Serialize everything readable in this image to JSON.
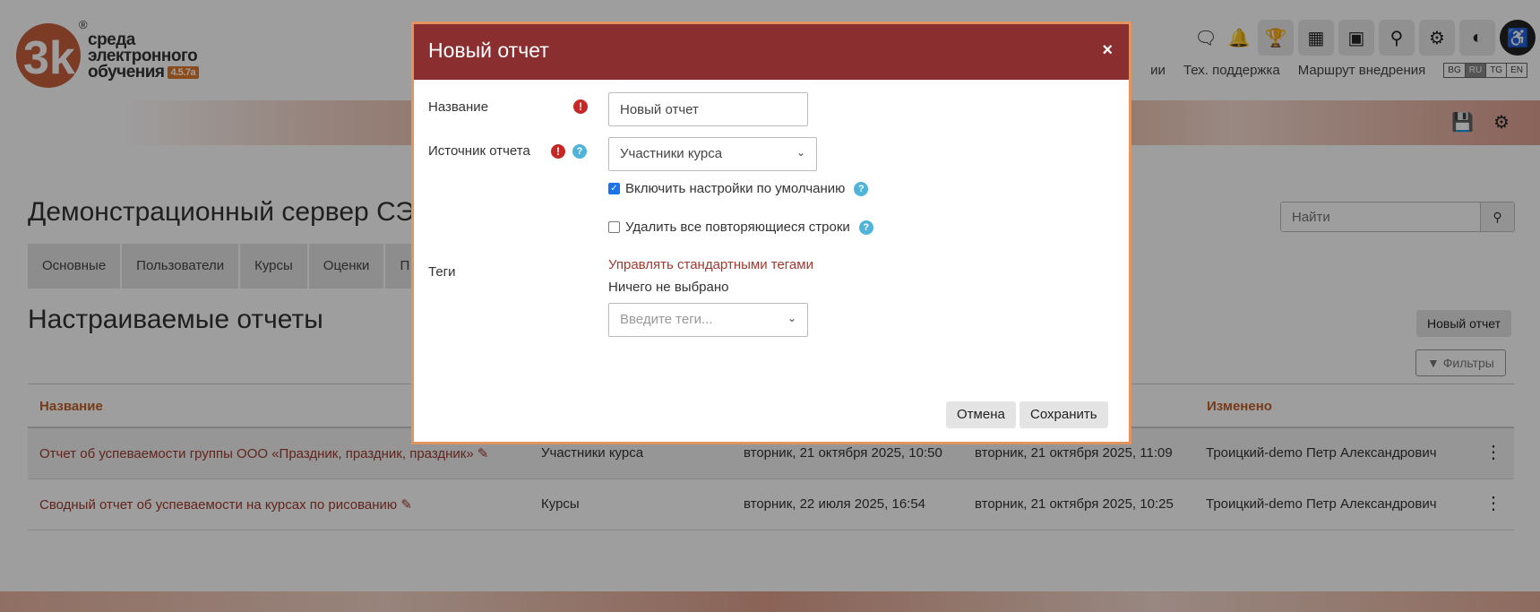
{
  "app": {
    "logo_letters": "3k",
    "logo_text_line1": "среда",
    "logo_text_line2": "электронного",
    "logo_text_line3": "обучения",
    "version": "4.5.7a",
    "reg_mark": "®"
  },
  "topbar": {
    "nav": [
      "ии",
      "Тех. поддержка",
      "Маршрут внедрения"
    ],
    "langs": [
      "BG",
      "RU",
      "TG",
      "EN"
    ],
    "active_lang": "RU",
    "icons": [
      "chat-icon",
      "bell-icon",
      "trophy-icon",
      "dashboard-icon",
      "gallery-icon",
      "search-icon",
      "gear-icon",
      "toggle-icon",
      "accessibility-icon"
    ]
  },
  "site": {
    "title": "Демонстрационный сервер СЭ"
  },
  "search": {
    "placeholder": "Найти"
  },
  "tabs": [
    "Основные",
    "Пользователи",
    "Курсы",
    "Оценки",
    "П"
  ],
  "page": {
    "heading": "Настраиваемые отчеты",
    "new_report_button": "Новый отчет",
    "filters_button": "Фильтры"
  },
  "table": {
    "headers": {
      "name": "Название",
      "modified": "Изменено"
    },
    "rows": [
      {
        "name": "Отчет об успеваемости группы ООО «Праздник, праздник, праздник»",
        "source": "Участники курса",
        "created": "вторник, 21 октября 2025, 10:50",
        "modified_at": "вторник, 21 октября 2025, 11:09",
        "author": "Троицкий-demo Петр Александрович"
      },
      {
        "name": "Сводный отчет об успеваемости на курсах по рисованию",
        "source": "Курсы",
        "created": "вторник, 22 июля 2025, 16:54",
        "modified_at": "вторник, 21 октября 2025, 10:25",
        "author": "Троицкий-demo Петр Александрович"
      }
    ]
  },
  "modal": {
    "title": "Новый отчет",
    "close": "×",
    "name_label": "Название",
    "name_value": "Новый отчет",
    "source_label": "Источник отчета",
    "source_value": "Участники курса",
    "default_settings_label": "Включить настройки по умолчанию",
    "default_settings_checked": true,
    "remove_duplicates_label": "Удалить все повторяющиеся строки",
    "remove_duplicates_checked": false,
    "tags_label": "Теги",
    "manage_tags_link": "Управлять стандартными тегами",
    "nothing_selected": "Ничего не выбрано",
    "tags_placeholder": "Введите теги...",
    "cancel_button": "Отмена",
    "save_button": "Сохранить",
    "req_glyph": "!",
    "help_glyph": "?"
  },
  "colors": {
    "modal_header": "#8b2e30",
    "accent_orange": "#c0602a",
    "link_red": "#a03a2f",
    "help_blue": "#4fb4d8",
    "required_red": "#c62828"
  }
}
